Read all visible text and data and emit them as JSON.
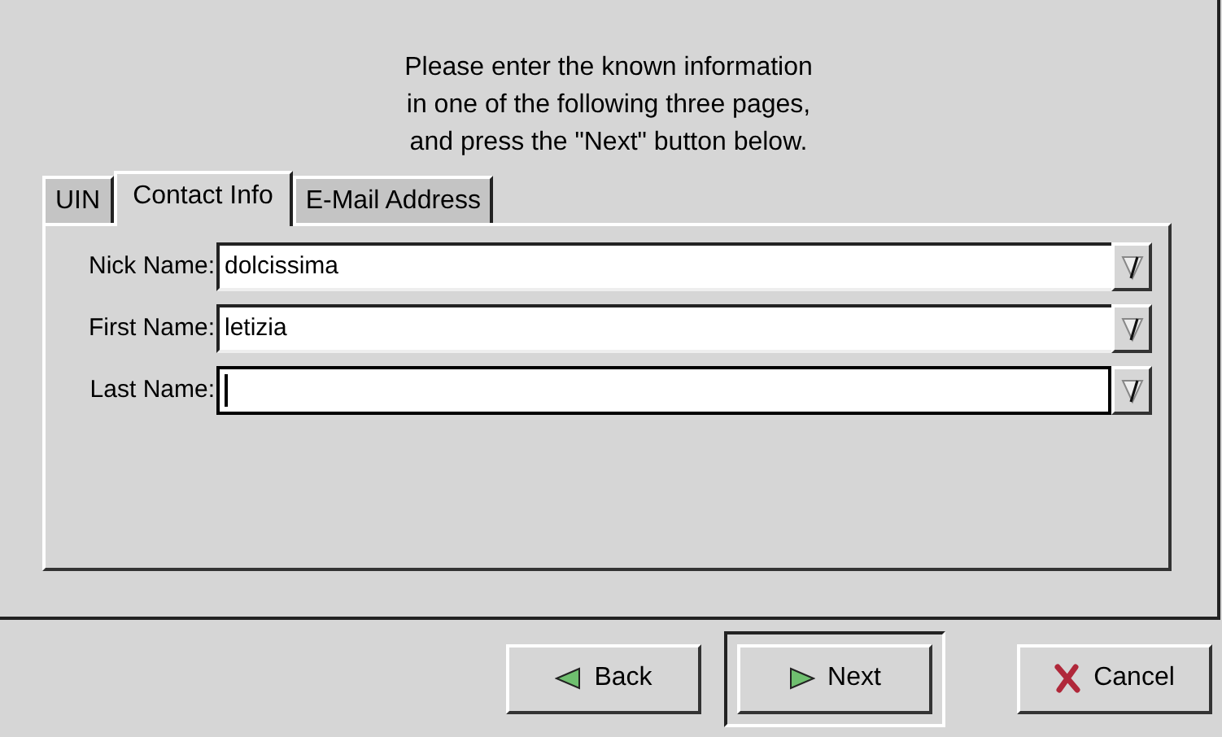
{
  "instructions": [
    "Please enter the known information",
    "in one of the following three pages,",
    "and press the \"Next\" button below."
  ],
  "tabs": [
    {
      "label": "UIN",
      "selected": false
    },
    {
      "label": "Contact Info",
      "selected": true
    },
    {
      "label": "E-Mail Address",
      "selected": false
    }
  ],
  "fields": [
    {
      "label": "Nick Name:",
      "value": "dolcissima",
      "focused": false
    },
    {
      "label": "First Name:",
      "value": "letizia",
      "focused": false
    },
    {
      "label": "Last Name:",
      "focused": true
    }
  ],
  "buttons": [
    {
      "kind": "back",
      "label": "Back",
      "default": false
    },
    {
      "kind": "next",
      "label": "Next",
      "default": true
    },
    {
      "kind": "cancel",
      "label": "Cancel",
      "default": false
    }
  ]
}
